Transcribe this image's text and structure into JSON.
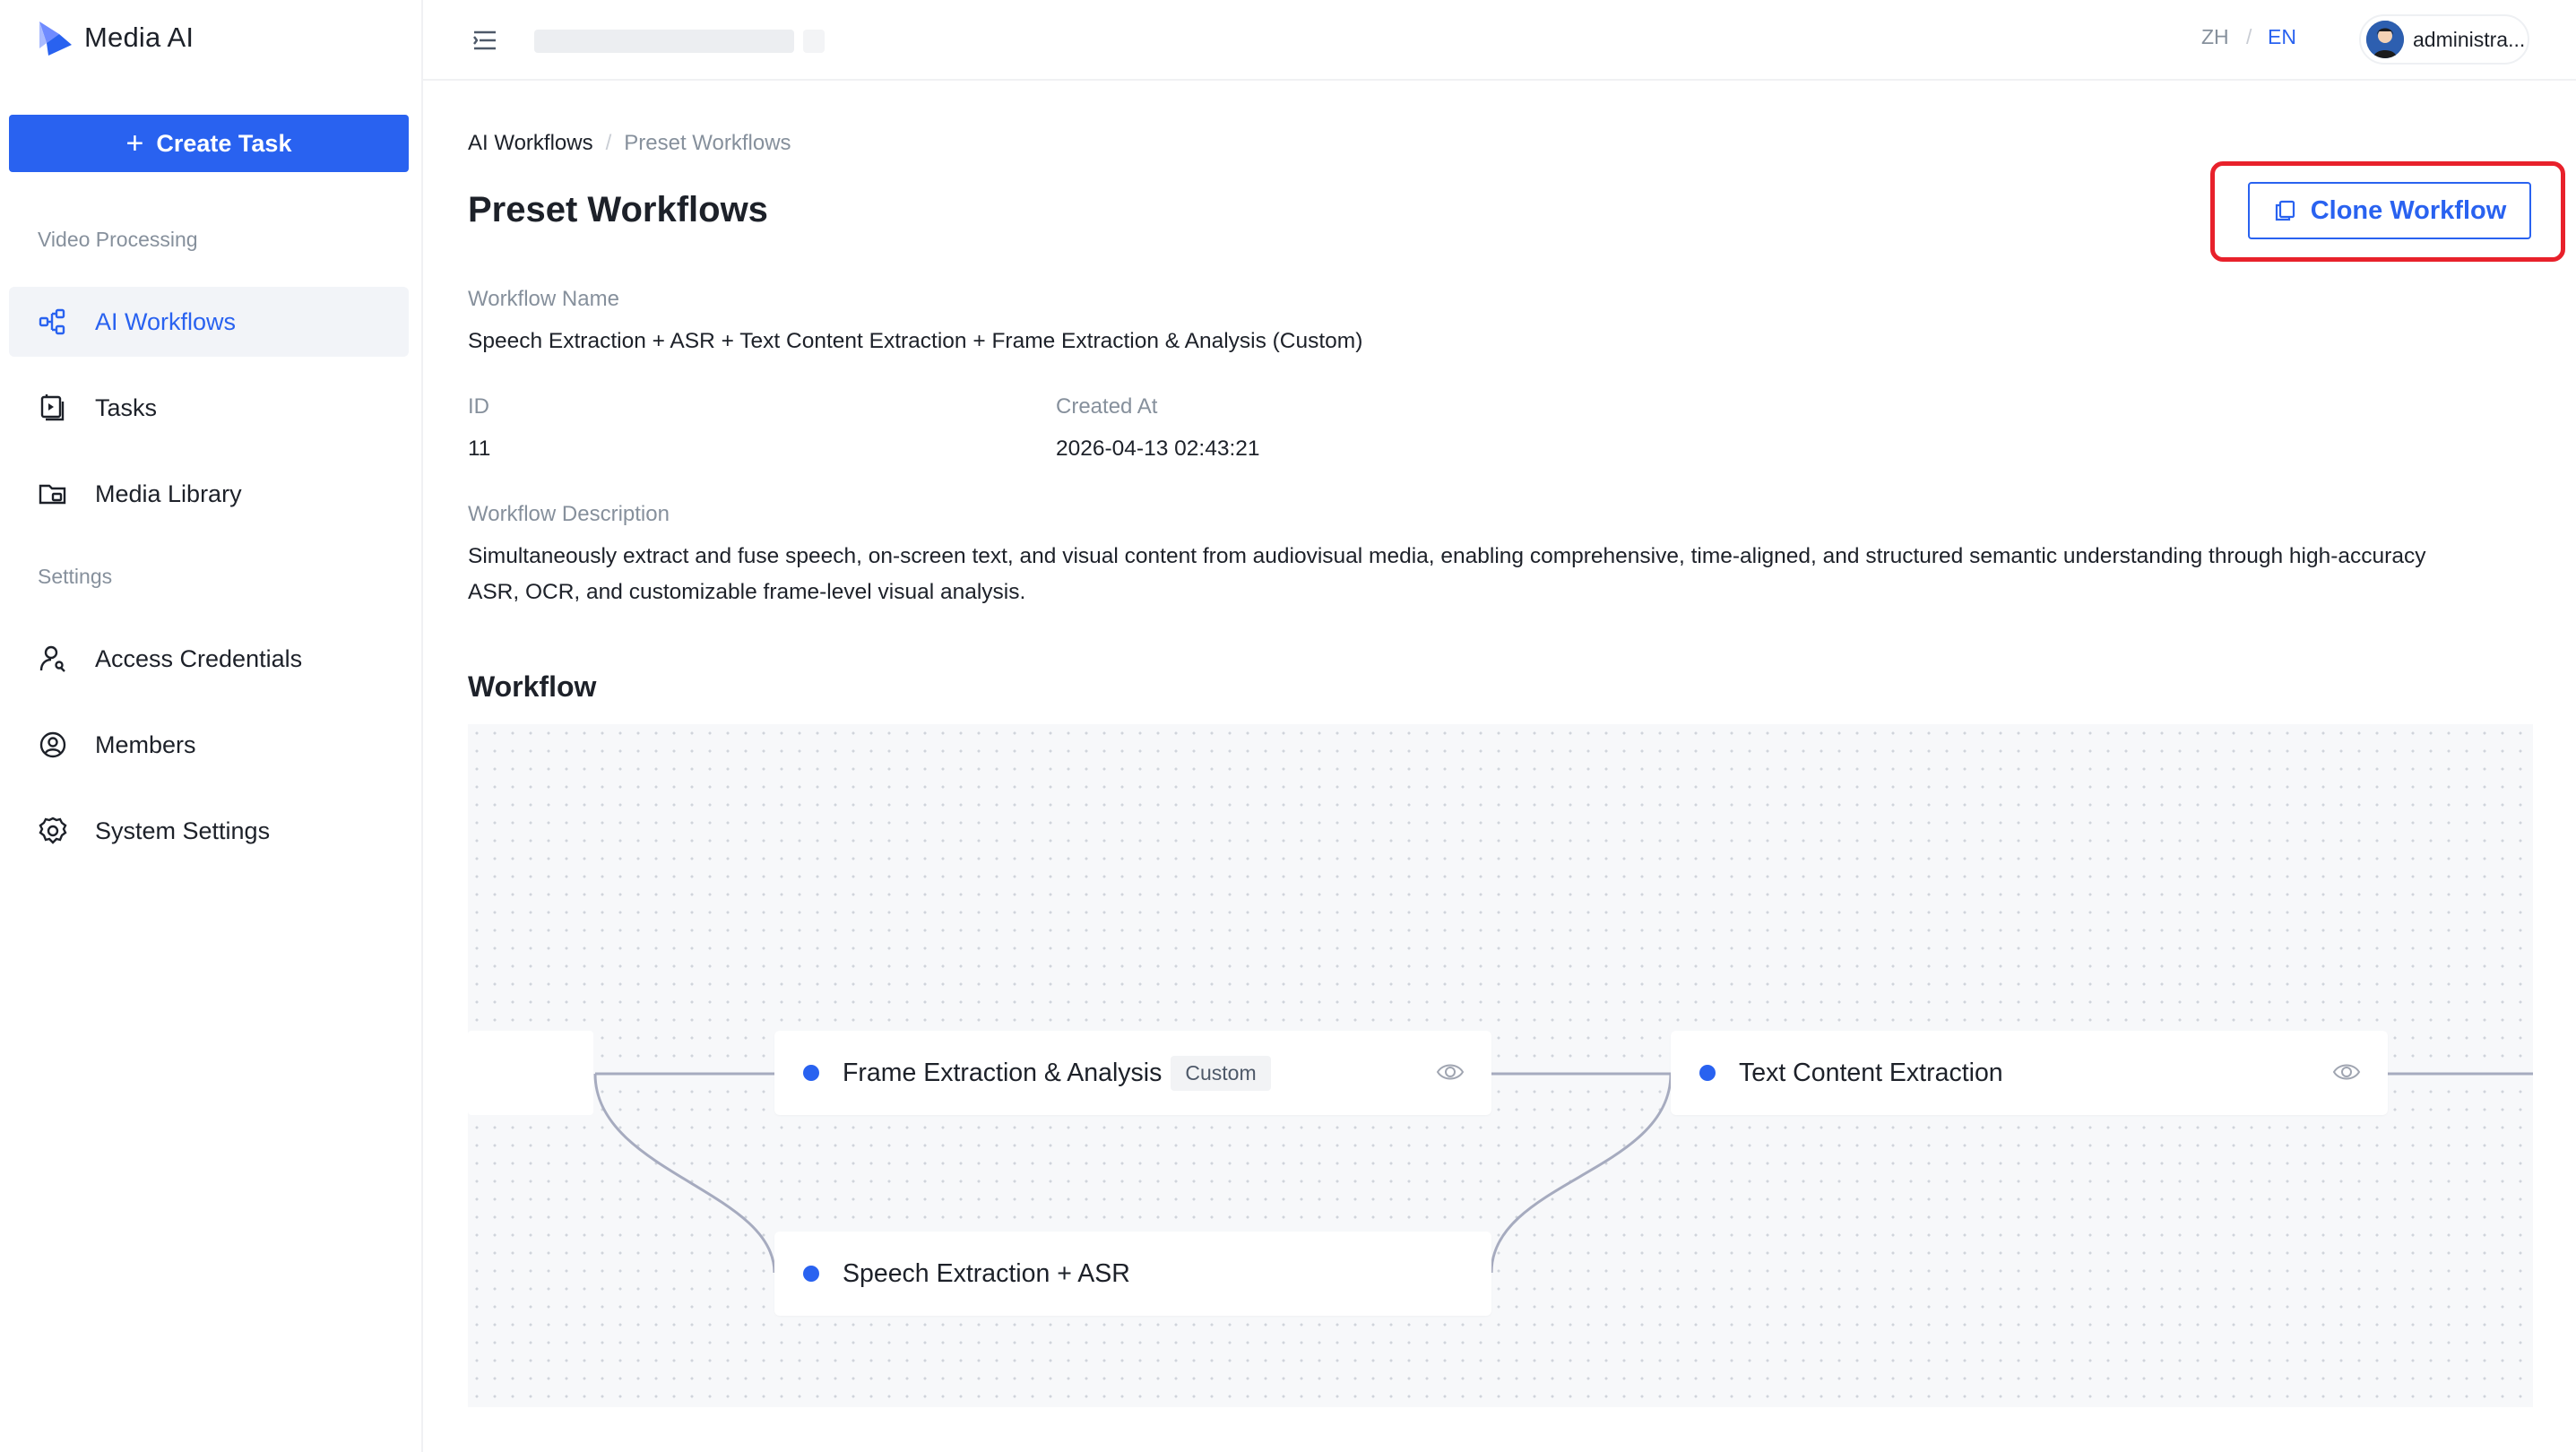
{
  "app": {
    "brand": "Media AI",
    "brand_accent": "#2962f0"
  },
  "sidebar": {
    "create_label": "Create Task",
    "group_video": "Video Processing",
    "group_settings": "Settings",
    "items": [
      {
        "label": "AI Workflows",
        "icon": "workflow-icon",
        "active": true
      },
      {
        "label": "Tasks",
        "icon": "tasks-icon"
      },
      {
        "label": "Media Library",
        "icon": "folder-icon"
      },
      {
        "label": "Access Credentials",
        "icon": "key-user-icon"
      },
      {
        "label": "Members",
        "icon": "user-circle-icon"
      },
      {
        "label": "System Settings",
        "icon": "gear-icon"
      }
    ]
  },
  "header": {
    "lang_zh": "ZH",
    "lang_sep": "/",
    "lang_en": "EN",
    "user_name": "administra..."
  },
  "breadcrumb": {
    "parent": "AI Workflows",
    "sep": "/",
    "current": "Preset Workflows"
  },
  "page": {
    "title": "Preset Workflows",
    "clone_label": "Clone Workflow",
    "workflow_name_label": "Workflow Name",
    "workflow_name": "Speech Extraction + ASR + Text Content Extraction + Frame Extraction & Analysis (Custom)",
    "id_label": "ID",
    "id_value": "11",
    "created_label": "Created At",
    "created_value": "2026-04-13 02:43:21",
    "desc_label": "Workflow Description",
    "desc_value": "Simultaneously extract and fuse speech, on-screen text, and visual content from audiovisual media, enabling comprehensive, time-aligned, and structured semantic understanding through high-accuracy ASR, OCR, and customizable frame-level visual analysis.",
    "workflow_section": "Workflow"
  },
  "workflow_nodes": {
    "frame": {
      "label": "Frame Extraction & Analysis",
      "tag": "Custom"
    },
    "text": {
      "label": "Text Content Extraction"
    },
    "speech": {
      "label": "Speech Extraction + ASR"
    }
  }
}
